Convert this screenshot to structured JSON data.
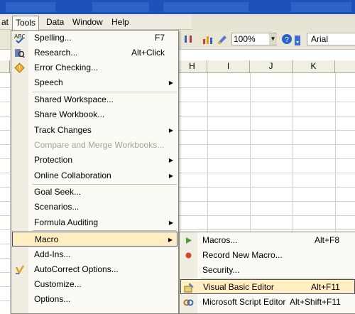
{
  "menubar": {
    "items": [
      {
        "label": "at"
      },
      {
        "label": "Tools"
      },
      {
        "label": "Data"
      },
      {
        "label": "Window"
      },
      {
        "label": "Help"
      }
    ]
  },
  "toolbar": {
    "zoom": "100%",
    "font": "Arial"
  },
  "columns": [
    "H",
    "I",
    "J",
    "K"
  ],
  "tools_menu": {
    "items": [
      {
        "label": "Spelling...",
        "shortcut": "F7",
        "icon": "spelling-icon"
      },
      {
        "label": "Research...",
        "shortcut": "Alt+Click",
        "icon": "research-icon"
      },
      {
        "label": "Error Checking...",
        "icon": "error-checking-icon"
      },
      {
        "label": "Speech",
        "submenu": true
      },
      {
        "label": "Shared Workspace..."
      },
      {
        "label": "Share Workbook..."
      },
      {
        "label": "Track Changes",
        "submenu": true
      },
      {
        "label": "Compare and Merge Workbooks...",
        "disabled": true
      },
      {
        "label": "Protection",
        "submenu": true
      },
      {
        "label": "Online Collaboration",
        "submenu": true
      },
      {
        "label": "Goal Seek..."
      },
      {
        "label": "Scenarios..."
      },
      {
        "label": "Formula Auditing",
        "submenu": true
      },
      {
        "label": "Macro",
        "submenu": true,
        "highlighted": true
      },
      {
        "label": "Add-Ins..."
      },
      {
        "label": "AutoCorrect Options...",
        "icon": "autocorrect-icon"
      },
      {
        "label": "Customize..."
      },
      {
        "label": "Options..."
      }
    ]
  },
  "macro_submenu": {
    "items": [
      {
        "label": "Macros...",
        "shortcut": "Alt+F8",
        "icon": "run-macro-icon"
      },
      {
        "label": "Record New Macro...",
        "icon": "record-macro-icon"
      },
      {
        "label": "Security..."
      },
      {
        "label": "Visual Basic Editor",
        "shortcut": "Alt+F11",
        "icon": "visual-basic-editor-icon",
        "highlighted": true
      },
      {
        "label": "Microsoft Script Editor",
        "shortcut": "Alt+Shift+F11",
        "icon": "script-editor-icon"
      }
    ]
  },
  "colors": {
    "menu_bg": "#fbfaf5",
    "highlight": "#ffeec2",
    "titlebar": "#1e52b8"
  }
}
